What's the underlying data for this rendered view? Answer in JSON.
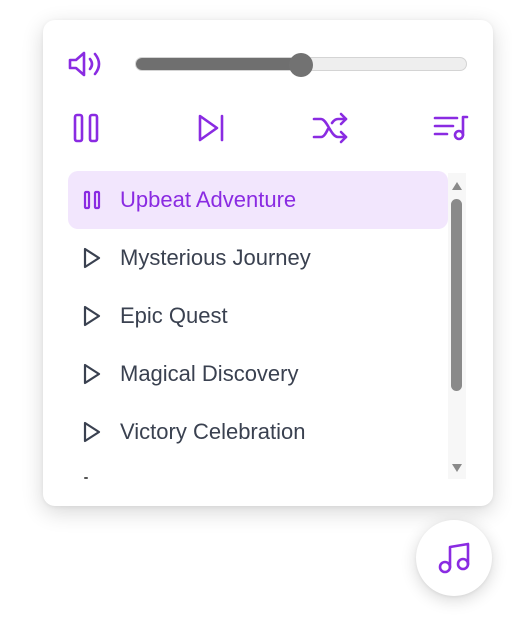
{
  "colors": {
    "accent": "#8a2be2",
    "active_row_bg": "#f2e6fd",
    "track_text": "#3a4150",
    "slider_fill": "#6f6f6f",
    "scroll_thumb": "#8a8a8a"
  },
  "volume": {
    "icon": "volume-icon",
    "level_percent": 50
  },
  "controls": [
    {
      "name": "pause",
      "icon": "pause-icon"
    },
    {
      "name": "next",
      "icon": "skip-next-icon"
    },
    {
      "name": "shuffle",
      "icon": "shuffle-icon"
    },
    {
      "name": "playlist",
      "icon": "playlist-icon"
    }
  ],
  "playlist": {
    "tracks": [
      {
        "title": "Upbeat Adventure",
        "active": true,
        "icon": "pause-icon"
      },
      {
        "title": "Mysterious Journey",
        "active": false,
        "icon": "play-icon"
      },
      {
        "title": "Epic Quest",
        "active": false,
        "icon": "play-icon"
      },
      {
        "title": "Magical Discovery",
        "active": false,
        "icon": "play-icon"
      },
      {
        "title": "Victory Celebration",
        "active": false,
        "icon": "play-icon"
      }
    ]
  },
  "fab": {
    "icon": "music-note-icon"
  }
}
